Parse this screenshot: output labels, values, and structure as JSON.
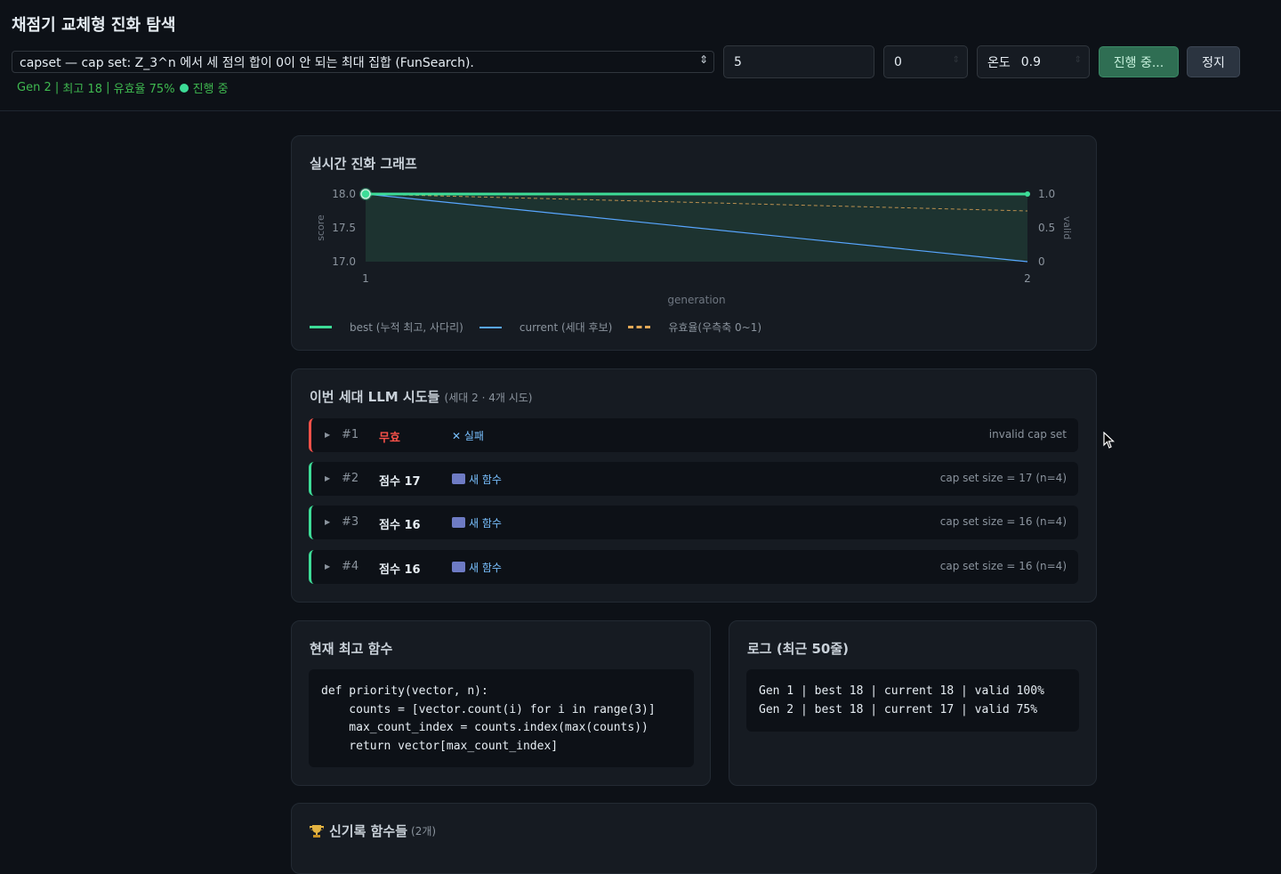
{
  "header": {
    "title": "채점기 교체형 진화 탐색",
    "problem_select": "capset — cap set: Z_3^n 에서 세 점의 합이 0이 안 되는 최대 집합 (FunSearch).",
    "status": {
      "gen": "Gen 2",
      "best": "최고 18",
      "valid": "유효율 75%",
      "state": "진행 중"
    },
    "population_value": "5",
    "seed_value": "0",
    "temperature_label": "온도",
    "temperature_value": "0.9",
    "running_button": "진행 중...",
    "stop_button": "정지"
  },
  "graph_panel": {
    "title": "실시간 진화 그래프",
    "legend": [
      {
        "label": "best (누적 최고, 사다리)",
        "color": "#3ddc97",
        "style": "solid"
      },
      {
        "label": "current (세대 후보)",
        "color": "#58a6ff",
        "style": "solid"
      },
      {
        "label": "유효율(우측축 0~1)",
        "color": "#e3a857",
        "style": "dashed"
      }
    ]
  },
  "chart_data": {
    "type": "line",
    "xlabel": "generation",
    "ylabel": "score",
    "y2label": "valid",
    "x": [
      1,
      2
    ],
    "x_ticks": [
      "1",
      "2"
    ],
    "ylim": [
      17.0,
      18.0
    ],
    "y_ticks": [
      "18.0",
      "17.5",
      "17.0"
    ],
    "y2lim": [
      0,
      1.0
    ],
    "y2_ticks": [
      "1.0",
      "0.5",
      "0"
    ],
    "series": [
      {
        "name": "best (누적 최고, 사다리)",
        "values": [
          18,
          18
        ],
        "color": "#3ddc97"
      },
      {
        "name": "current (세대 후보)",
        "values": [
          18,
          17
        ],
        "color": "#58a6ff"
      },
      {
        "name": "유효율(우측축 0~1)",
        "values": [
          1.0,
          0.75
        ],
        "axis": "right",
        "color": "#e3a857"
      }
    ]
  },
  "attempts_panel": {
    "title": "이번 세대 LLM 시도들",
    "subtitle": "(세대 2 · 4개 시도)",
    "items": [
      {
        "num": "#1",
        "score": "무효",
        "tag": "✕ 실패",
        "detail": "invalid cap set"
      },
      {
        "num": "#2",
        "score": "점수 17",
        "tag": "새 함수",
        "detail": "cap set size = 17 (n=4)"
      },
      {
        "num": "#3",
        "score": "점수 16",
        "tag": "새 함수",
        "detail": "cap set size = 16 (n=4)"
      },
      {
        "num": "#4",
        "score": "점수 16",
        "tag": "새 함수",
        "detail": "cap set size = 16 (n=4)"
      }
    ]
  },
  "best_panel": {
    "title": "현재 최고 함수",
    "code": "def priority(vector, n):\n    counts = [vector.count(i) for i in range(3)]\n    max_count_index = counts.index(max(counts))\n    return vector[max_count_index]"
  },
  "log_panel": {
    "title": "로그 (최근 50줄)",
    "lines": "Gen 1 | best 18 | current 18 | valid 100%\nGen 2 | best 18 | current 17 | valid 75%"
  },
  "records_panel": {
    "title": "신기록 함수들",
    "count": "(2개)"
  }
}
